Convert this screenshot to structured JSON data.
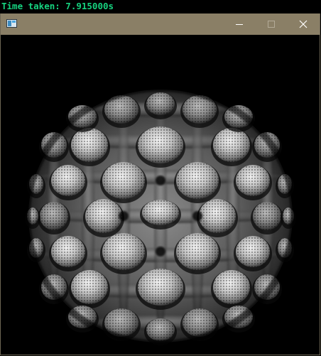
{
  "console": {
    "time_text": "Time taken: 7.915000s"
  },
  "window": {
    "title": "",
    "titlebar_color": "#8a7f66",
    "controls": {
      "minimize_icon": "minimize-icon",
      "maximize_icon": "maximize-icon",
      "close_icon": "close-icon"
    }
  },
  "render": {
    "subject": "mandelbulb-fractal",
    "background_color": "#000000",
    "shading": "grayscale"
  },
  "colors": {
    "console_text": "#16d27f",
    "titlebar": "#8a7f66"
  }
}
